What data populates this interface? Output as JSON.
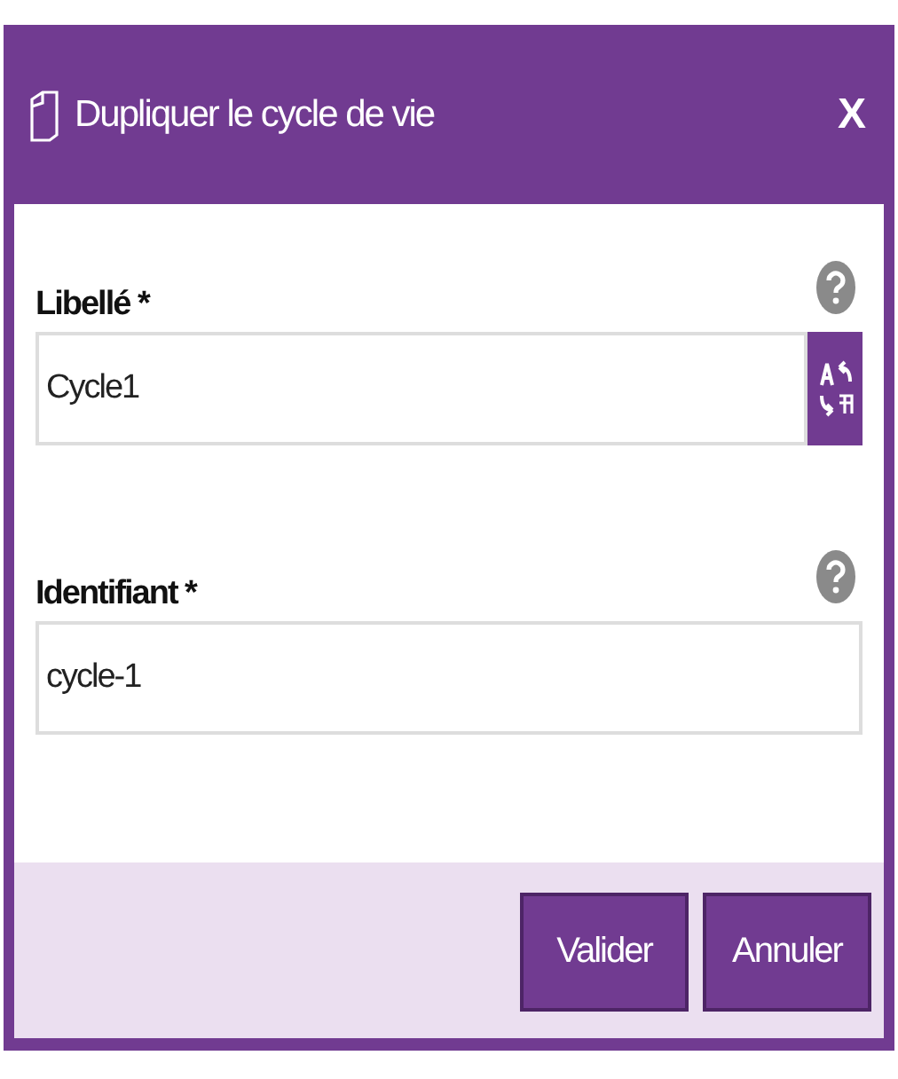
{
  "dialog": {
    "title": "Dupliquer le cycle de vie",
    "close": "X"
  },
  "fields": [
    {
      "kind": "translatable",
      "label": "Libellé *",
      "value": "Cycle1"
    },
    {
      "kind": "plain",
      "label": "Identifiant *",
      "value": "cycle-1"
    }
  ],
  "buttons": [
    "Valider",
    "Annuler"
  ]
}
